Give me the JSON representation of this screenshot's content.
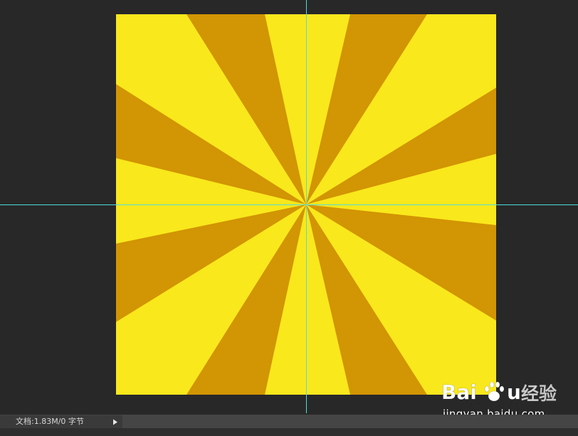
{
  "app": {
    "workspace_bg": "#282828",
    "guide_color": "#4fdcdc"
  },
  "canvas": {
    "colors": {
      "background": "#f9e81c",
      "ray": "#d29503"
    }
  },
  "status_bar": {
    "doc_info": "文档:1.83M/0 字节",
    "menu_arrow_icon": "triangle-right-icon"
  },
  "watermark": {
    "brand": "Baidu 经验",
    "url": "jingyan.baidu.com"
  }
}
